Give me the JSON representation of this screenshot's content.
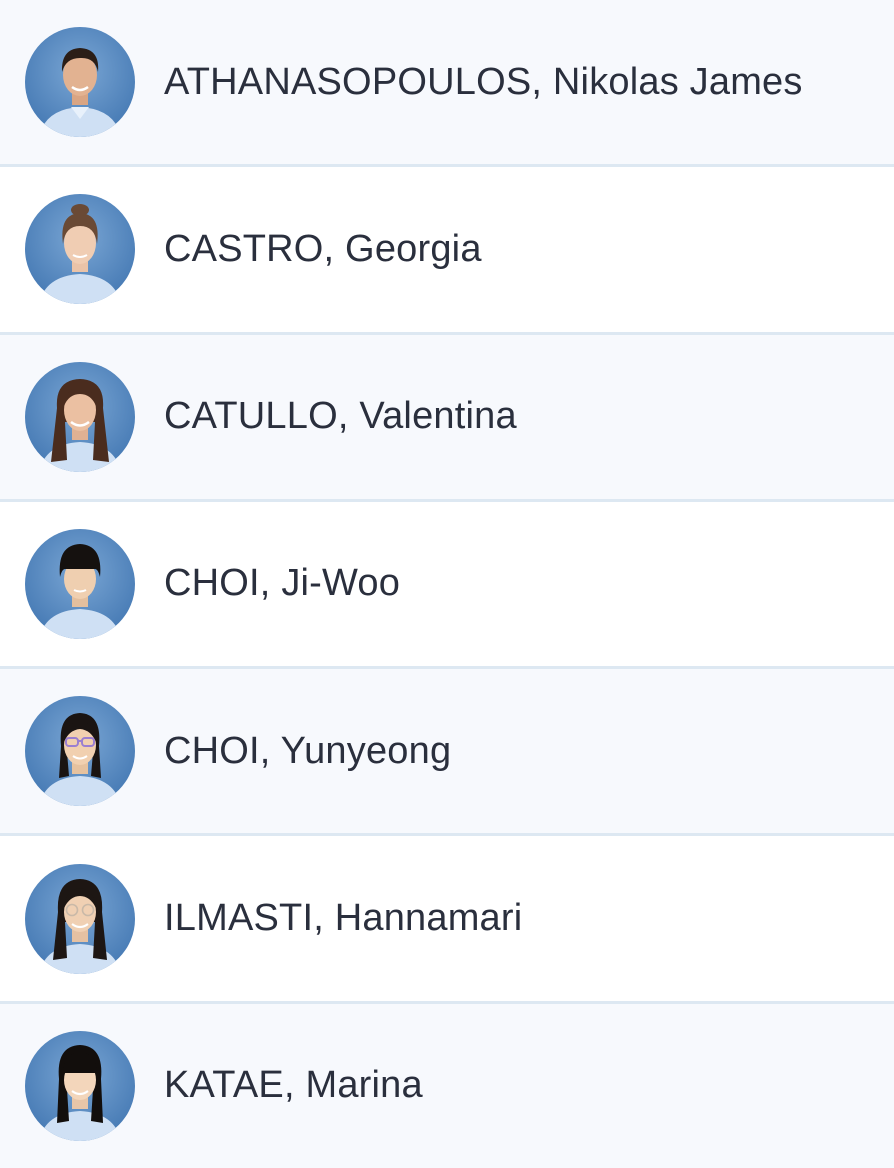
{
  "students": [
    {
      "name": "ATHANASOPOULOS, Nikolas James",
      "hair": "short-dark"
    },
    {
      "name": "CASTRO, Georgia",
      "hair": "updo-brown"
    },
    {
      "name": "CATULLO, Valentina",
      "hair": "long-brown"
    },
    {
      "name": "CHOI, Ji-Woo",
      "hair": "bowl-black"
    },
    {
      "name": "CHOI, Yunyeong",
      "hair": "pulled-black",
      "glasses": "purple"
    },
    {
      "name": "ILMASTI, Hannamari",
      "hair": "long-black",
      "glasses": "clear"
    },
    {
      "name": "KATAE, Marina",
      "hair": "long-black-bangs"
    }
  ],
  "colors": {
    "backdrop": "#5d8fc4",
    "shirt": "#cfe0f4",
    "text": "#2a2f3d",
    "divider": "#dde8f2",
    "row_alt": "#f7f9fd"
  }
}
